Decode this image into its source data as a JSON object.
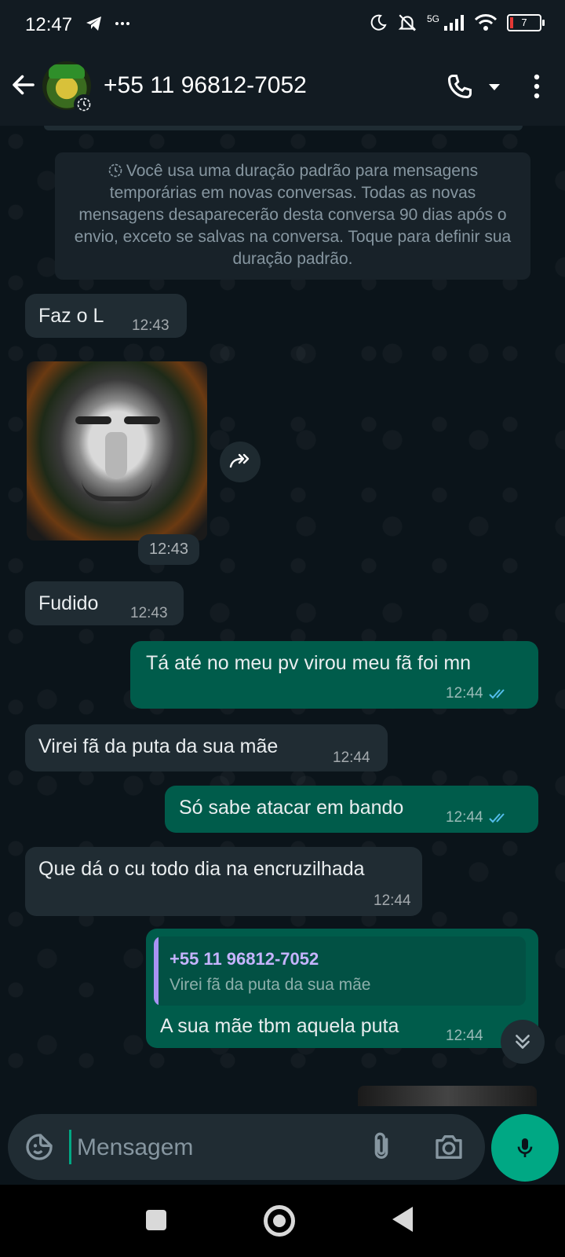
{
  "status_bar": {
    "time": "12:47",
    "network": "5G",
    "battery": "7"
  },
  "header": {
    "contact_name": "+55 11 96812-7052"
  },
  "system_notice": "Você usa uma duração padrão para mensagens temporárias em novas conversas. Todas as novas mensagens desaparecerão desta conversa 90 dias após o envio, exceto se salvas na conversa. Toque para definir sua duração padrão.",
  "messages": [
    {
      "dir": "in",
      "text": "Faz o L",
      "time": "12:43"
    },
    {
      "dir": "in",
      "type": "image",
      "time": "12:43"
    },
    {
      "dir": "in",
      "text": "Fudido",
      "time": "12:43"
    },
    {
      "dir": "out",
      "text": "Tá até no meu pv virou meu fã foi mn",
      "time": "12:44"
    },
    {
      "dir": "in",
      "text": "Virei fã da puta da sua mãe",
      "time": "12:44"
    },
    {
      "dir": "out",
      "text": "Só sabe atacar em bando",
      "time": "12:44"
    },
    {
      "dir": "in",
      "text": "Que dá o cu todo dia na encruzilhada",
      "time": "12:44"
    },
    {
      "dir": "out",
      "text": "A sua mãe tbm aquela puta",
      "time": "12:44",
      "quoted": {
        "author": "+55 11 96812-7052",
        "text": "Virei fã da puta da sua mãe"
      }
    }
  ],
  "composer": {
    "placeholder": "Mensagem"
  },
  "colors": {
    "outgoing_bubble": "#005c4b",
    "incoming_bubble": "#202c33",
    "accent": "#00a884",
    "read_ticks": "#53bdeb"
  }
}
